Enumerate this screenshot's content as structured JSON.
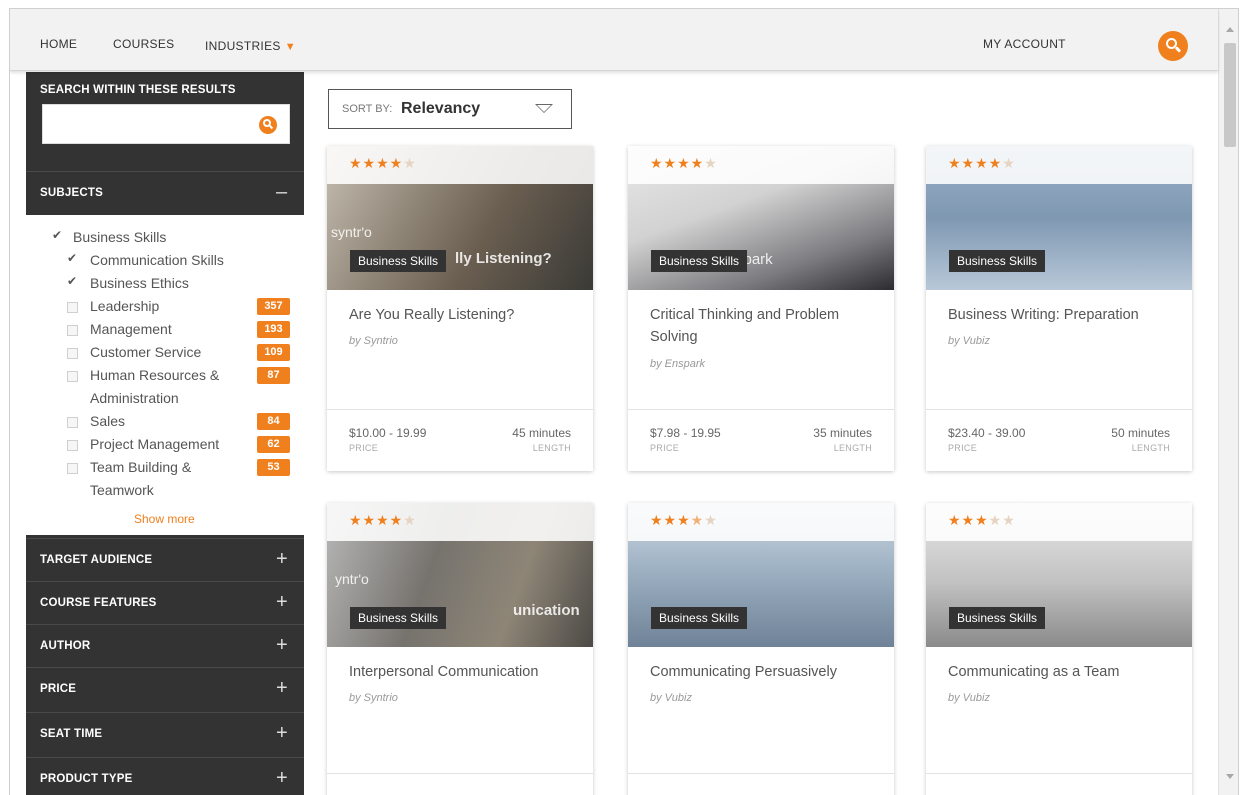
{
  "nav": {
    "items": [
      "HOME",
      "COURSES",
      "INDUSTRIES"
    ],
    "account": "MY ACCOUNT"
  },
  "sidebar": {
    "search_title": "SEARCH WITHIN THESE RESULTS",
    "search_placeholder": "",
    "subjects_label": "SUBJECTS",
    "subjects_toggle": "–",
    "subjects": [
      {
        "label": "Business Skills",
        "checked": true,
        "count": ""
      },
      {
        "label": "Communication Skills",
        "checked": true,
        "count": ""
      },
      {
        "label": "Business Ethics",
        "checked": true,
        "count": ""
      },
      {
        "label": "Leadership",
        "checked": false,
        "count": "357"
      },
      {
        "label": "Management",
        "checked": false,
        "count": "193"
      },
      {
        "label": "Customer Service",
        "checked": false,
        "count": "109"
      },
      {
        "label": "Human Resources & Administration",
        "checked": false,
        "count": "87"
      },
      {
        "label": "Sales",
        "checked": false,
        "count": "84"
      },
      {
        "label": "Project Management",
        "checked": false,
        "count": "62"
      },
      {
        "label": "Team Building & Teamwork",
        "checked": false,
        "count": "53"
      }
    ],
    "show_more": "Show more",
    "sections": [
      {
        "label": "TARGET AUDIENCE",
        "toggle": "+"
      },
      {
        "label": "COURSE FEATURES",
        "toggle": "+"
      },
      {
        "label": "AUTHOR",
        "toggle": "+"
      },
      {
        "label": "PRICE",
        "toggle": "+"
      },
      {
        "label": "SEAT TIME",
        "toggle": "+"
      },
      {
        "label": "PRODUCT TYPE",
        "toggle": "+"
      }
    ]
  },
  "sort": {
    "prefix": "SORT BY:",
    "value": "Relevancy"
  },
  "cards": [
    {
      "title": "Are You Really Listening?",
      "author": "by Syntrio",
      "category": "Business Skills",
      "rating": 4,
      "price": "$10.00 - 19.99",
      "price_label": "PRICE",
      "length": "45 minutes",
      "length_label": "LENGTH"
    },
    {
      "title": "Critical Thinking and Problem Solving",
      "author": "by Enspark",
      "category": "Business Skills",
      "rating": 4,
      "price": "$7.98 - 19.95",
      "price_label": "PRICE",
      "length": "35 minutes",
      "length_label": "LENGTH"
    },
    {
      "title": "Business Writing: Preparation",
      "author": "by Vubiz",
      "category": "Business Skills",
      "rating": 4,
      "price": "$23.40 - 39.00",
      "price_label": "PRICE",
      "length": "50 minutes",
      "length_label": "LENGTH"
    },
    {
      "title": "Interpersonal Communication",
      "author": "by Syntrio",
      "category": "Business Skills",
      "rating": 4,
      "price": "",
      "price_label": "",
      "length": "",
      "length_label": ""
    },
    {
      "title": "Communicating Persuasively",
      "author": "by Vubiz",
      "category": "Business Skills",
      "rating": 3.5,
      "price": "",
      "price_label": "",
      "length": "",
      "length_label": ""
    },
    {
      "title": "Communicating as a Team",
      "author": "by Vubiz",
      "category": "Business Skills",
      "rating": 3,
      "price": "",
      "price_label": "",
      "length": "",
      "length_label": ""
    }
  ],
  "image_overlays": {
    "card1_brand": "syntr'o",
    "card1_text": "lly Listening?",
    "card2_text": "spark",
    "card4_brand": "yntr'o",
    "card4_text": "unication"
  },
  "colors": {
    "accent": "#f0801e",
    "sidebar_bg": "#333333",
    "nav_bg": "#f2f2f2"
  },
  "icons": {
    "search": "search-icon",
    "dropdown": "chevron-down-icon",
    "star": "star-icon"
  }
}
